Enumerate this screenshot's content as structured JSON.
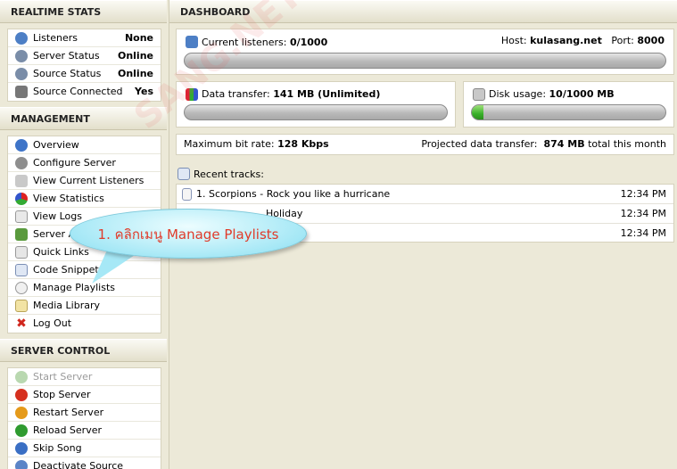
{
  "realtime": {
    "title": "REALTIME STATS",
    "rows": [
      {
        "label": "Listeners",
        "value": "None",
        "icon": "users-icon",
        "color": "#4d7fc5"
      },
      {
        "label": "Server Status",
        "value": "Online",
        "icon": "broadcast-icon",
        "color": "#7a8da8"
      },
      {
        "label": "Source Status",
        "value": "Online",
        "icon": "broadcast-icon",
        "color": "#7a8da8"
      },
      {
        "label": "Source Connected",
        "value": "Yes",
        "icon": "speaker-icon",
        "color": "#777777"
      }
    ]
  },
  "management": {
    "title": "MANAGEMENT",
    "items": [
      {
        "label": "Overview",
        "icon": "info-icon"
      },
      {
        "label": "Configure Server",
        "icon": "gear-icon"
      },
      {
        "label": "View Current Listeners",
        "icon": "users-icon"
      },
      {
        "label": "View Statistics",
        "icon": "pie-chart-icon"
      },
      {
        "label": "View Logs",
        "icon": "log-icon"
      },
      {
        "label": "Server A",
        "icon": "server-icon"
      },
      {
        "label": "Quick Links",
        "icon": "link-icon"
      },
      {
        "label": "Code Snippets",
        "icon": "page-icon"
      },
      {
        "label": "Manage Playlists",
        "icon": "disc-icon"
      },
      {
        "label": "Media Library",
        "icon": "folder-icon"
      },
      {
        "label": "Log Out",
        "icon": "x-icon"
      }
    ]
  },
  "server_control": {
    "title": "SERVER CONTROL",
    "items": [
      {
        "label": "Start Server",
        "icon": "play-icon",
        "disabled": true
      },
      {
        "label": "Stop Server",
        "icon": "stop-icon",
        "disabled": false
      },
      {
        "label": "Restart Server",
        "icon": "restart-icon",
        "disabled": false
      },
      {
        "label": "Reload Server",
        "icon": "reload-icon",
        "disabled": false
      },
      {
        "label": "Skip Song",
        "icon": "skip-icon",
        "disabled": false
      },
      {
        "label": "Deactivate Source",
        "icon": "deactivate-icon",
        "disabled": false
      }
    ]
  },
  "dashboard": {
    "title": "DASHBOARD",
    "listeners_label": "Current listeners:",
    "listeners_value": "0/1000",
    "listeners_fraction": 0.0,
    "host_label": "Host:",
    "host_value": "kulasang.net",
    "port_label": "Port:",
    "port_value": "8000",
    "transfer_label": "Data transfer:",
    "transfer_value": "141 MB (Unlimited)",
    "transfer_fraction": 0.0,
    "disk_label": "Disk usage:",
    "disk_value": "10/1000 MB",
    "disk_fraction": 0.01,
    "bitrate_label": "Maximum bit rate:",
    "bitrate_value": "128 Kbps",
    "projected_label": "Projected data transfer:",
    "projected_value": "874 MB",
    "projected_suffix": "total this month",
    "recent_label": "Recent tracks:",
    "tracks": [
      {
        "title": "1. Scorpions - Rock you like a hurricane",
        "time": "12:34 PM"
      },
      {
        "title": "Holiday",
        "time": "12:34 PM"
      },
      {
        "title": "",
        "time": "12:34 PM"
      }
    ]
  },
  "callout": {
    "text": "1. คลิกเมนู Manage Playlists"
  },
  "watermark": "SANG.NET"
}
